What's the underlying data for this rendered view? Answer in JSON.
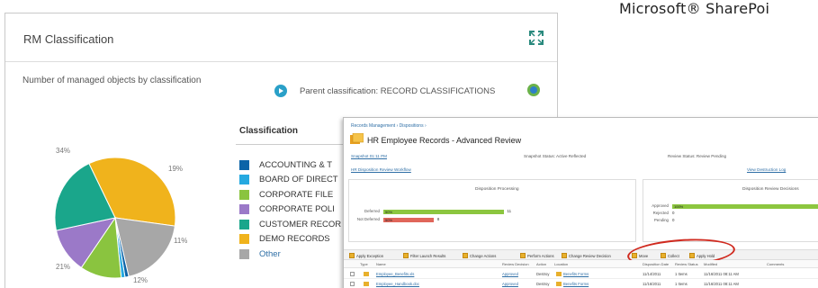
{
  "brand": {
    "text": "Microsoft® SharePoi"
  },
  "panel": {
    "title": "RM Classification",
    "subtitle": "Number of managed objects by classification",
    "parent_label": "Parent classification: RECORD CLASSIFICATIONS",
    "legend_heading": "Classification"
  },
  "chart_data": {
    "type": "pie",
    "title": "",
    "slice_labels": [
      "34%",
      "19%",
      "11%",
      "12%",
      "21%"
    ],
    "slices": [
      {
        "label": "DEMO RECORDS",
        "value": 34,
        "color": "#f0b31c"
      },
      {
        "label": "Other",
        "value": 19,
        "color": "#a7a7a7"
      },
      {
        "label": "ACCOUNTING & T",
        "value": 1,
        "color": "#0c64a8"
      },
      {
        "label": "BOARD OF DIRECT",
        "value": 1,
        "color": "#25a9e0"
      },
      {
        "label": "CORPORATE FILE",
        "value": 11,
        "color": "#8ac43f"
      },
      {
        "label": "CORPORATE POLI",
        "value": 12,
        "color": "#9b79c8"
      },
      {
        "label": "CUSTOMER RECOR",
        "value": 21,
        "color": "#1aa68b"
      }
    ]
  },
  "legend": [
    {
      "label": "ACCOUNTING & T",
      "color": "#0c64a8",
      "link": false
    },
    {
      "label": "BOARD OF DIRECT",
      "color": "#25a9e0",
      "link": false
    },
    {
      "label": "CORPORATE FILE",
      "color": "#8ac43f",
      "link": false
    },
    {
      "label": "CORPORATE POLI",
      "color": "#9b79c8",
      "link": false
    },
    {
      "label": "CUSTOMER RECOR",
      "color": "#1aa68b",
      "link": false
    },
    {
      "label": "DEMO RECORDS",
      "color": "#f0b31c",
      "link": false
    },
    {
      "label": "Other",
      "color": "#a7a7a7",
      "link": true
    }
  ],
  "hr": {
    "breadcrumb": "Records Management › Dispositions ›",
    "title": "HR Employee Records - Advanced Review",
    "snapshot_link": "Snapshot 01:11 PM",
    "snapshot_status": "Snapshot Status: Active Reflected",
    "review_status": "Review Status: Review Pending",
    "workflow_link": "HR Disposition Review Workflow",
    "log_link": "View Destruction Log",
    "left_chart": {
      "title": "Disposition Processing",
      "rows": [
        {
          "label": "Deferred",
          "text": "50%",
          "value": "11",
          "fraction": 0.5,
          "color": "#8cc63f"
        },
        {
          "label": "Not Deferred",
          "text": "50%",
          "value": "8",
          "fraction": 0.38,
          "color": "#e0665a"
        }
      ]
    },
    "right_chart": {
      "title": "Disposition Review Decisions",
      "rows": [
        {
          "label": "Approved",
          "text": "100%",
          "fraction": 1.0,
          "color": "#8cc63f"
        },
        {
          "label": "Rejected",
          "text": "0"
        },
        {
          "label": "Pending",
          "text": "0"
        }
      ]
    },
    "toolbar": [
      "Apply Exception",
      "Filter Launch Results",
      "Change Actions",
      "Perform Actions",
      "Change Review Decision",
      "Move",
      "Collect",
      "Apply Hold"
    ],
    "grid_headers": [
      "Type",
      "Name",
      "Review Decision",
      "Action",
      "Location",
      "Disposition Date",
      "Review Status",
      "Modified",
      "Comments"
    ],
    "grid_rows": [
      {
        "name": "Employee_Benefits.xls",
        "decision": "Approved",
        "action": "Destroy",
        "location": "Benefits Forms",
        "date": "11/14/2011",
        "status": "1 Items",
        "modified": "11/16/2011 08:11 AM"
      },
      {
        "name": "Employee_Handbook.doc",
        "decision": "Approved",
        "action": "Destroy",
        "location": "Benefits Forms",
        "date": "11/16/2011",
        "status": "1 Items",
        "modified": "11/16/2011 08:11 AM"
      }
    ]
  }
}
